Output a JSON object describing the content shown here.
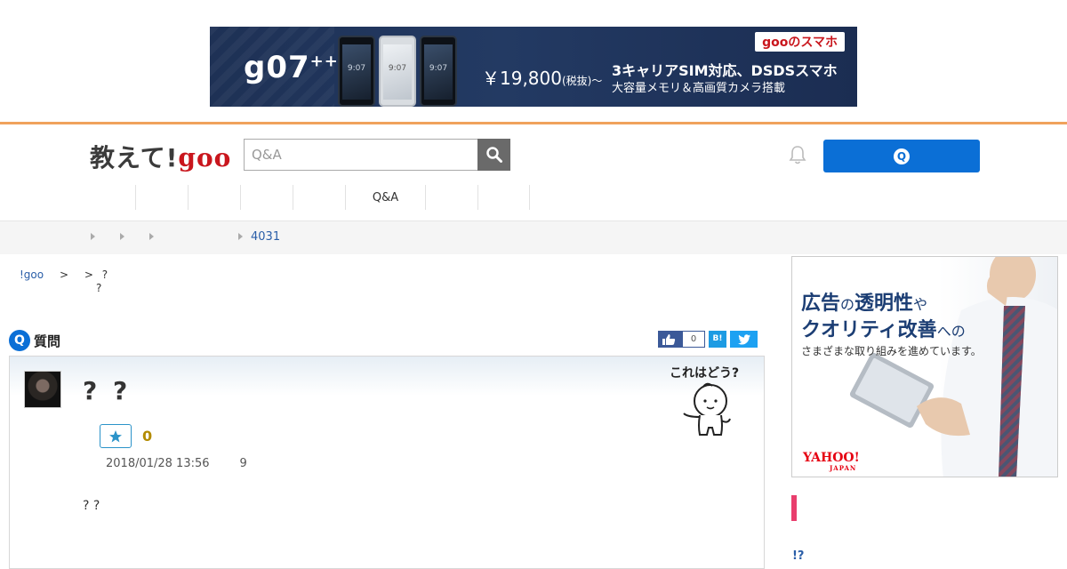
{
  "top_ad": {
    "model": "g07",
    "model_suffix": "++",
    "phone_screen_text": "9:07",
    "price": "￥19,800",
    "price_note": "(税抜)～",
    "brand": "gooのスマホ",
    "line1": "3キャリアSIM対応、DSDSスマホ",
    "line2": "大容量メモリ＆高画質カメラ搭載"
  },
  "header": {
    "logo_text": "教えて!",
    "logo_goo": "goo",
    "search_placeholder": "Q&A",
    "ask_button_icon": "Q"
  },
  "nav": {
    "items": [
      "",
      "",
      "",
      "",
      "Q&A",
      "",
      "",
      ""
    ]
  },
  "breadcrumb": {
    "count_text": "4031"
  },
  "sub_breadcrumb": {
    "site": "!goo",
    "sep1": ">",
    "sep2": ">",
    "line1": "?",
    "line2": "?"
  },
  "question_header": {
    "label": "質問",
    "icon_letter": "Q",
    "fb_count": "0",
    "hatena_label": "B!"
  },
  "question": {
    "title": "? ?",
    "fav_count": "0",
    "date": "2018/01/28 13:56",
    "views": "9",
    "body": "? ?",
    "mascot_caption": "これはどう?"
  },
  "side_ad": {
    "line1_main": "広告",
    "line1_small": "の",
    "line1_main2": "透明性",
    "line1_small2": "や",
    "line2_main": "クオリティ改善",
    "line2_small": "への",
    "line3": "さまざまな取り組みを進めています。",
    "logo": "YAHOO!",
    "logo_sub": "JAPAN"
  },
  "side": {
    "exq": "!?"
  },
  "colors": {
    "accent_blue": "#0b6fd6",
    "header_orange": "#f0a25c",
    "goo_red": "#c9161d",
    "pink": "#e93e6d"
  }
}
